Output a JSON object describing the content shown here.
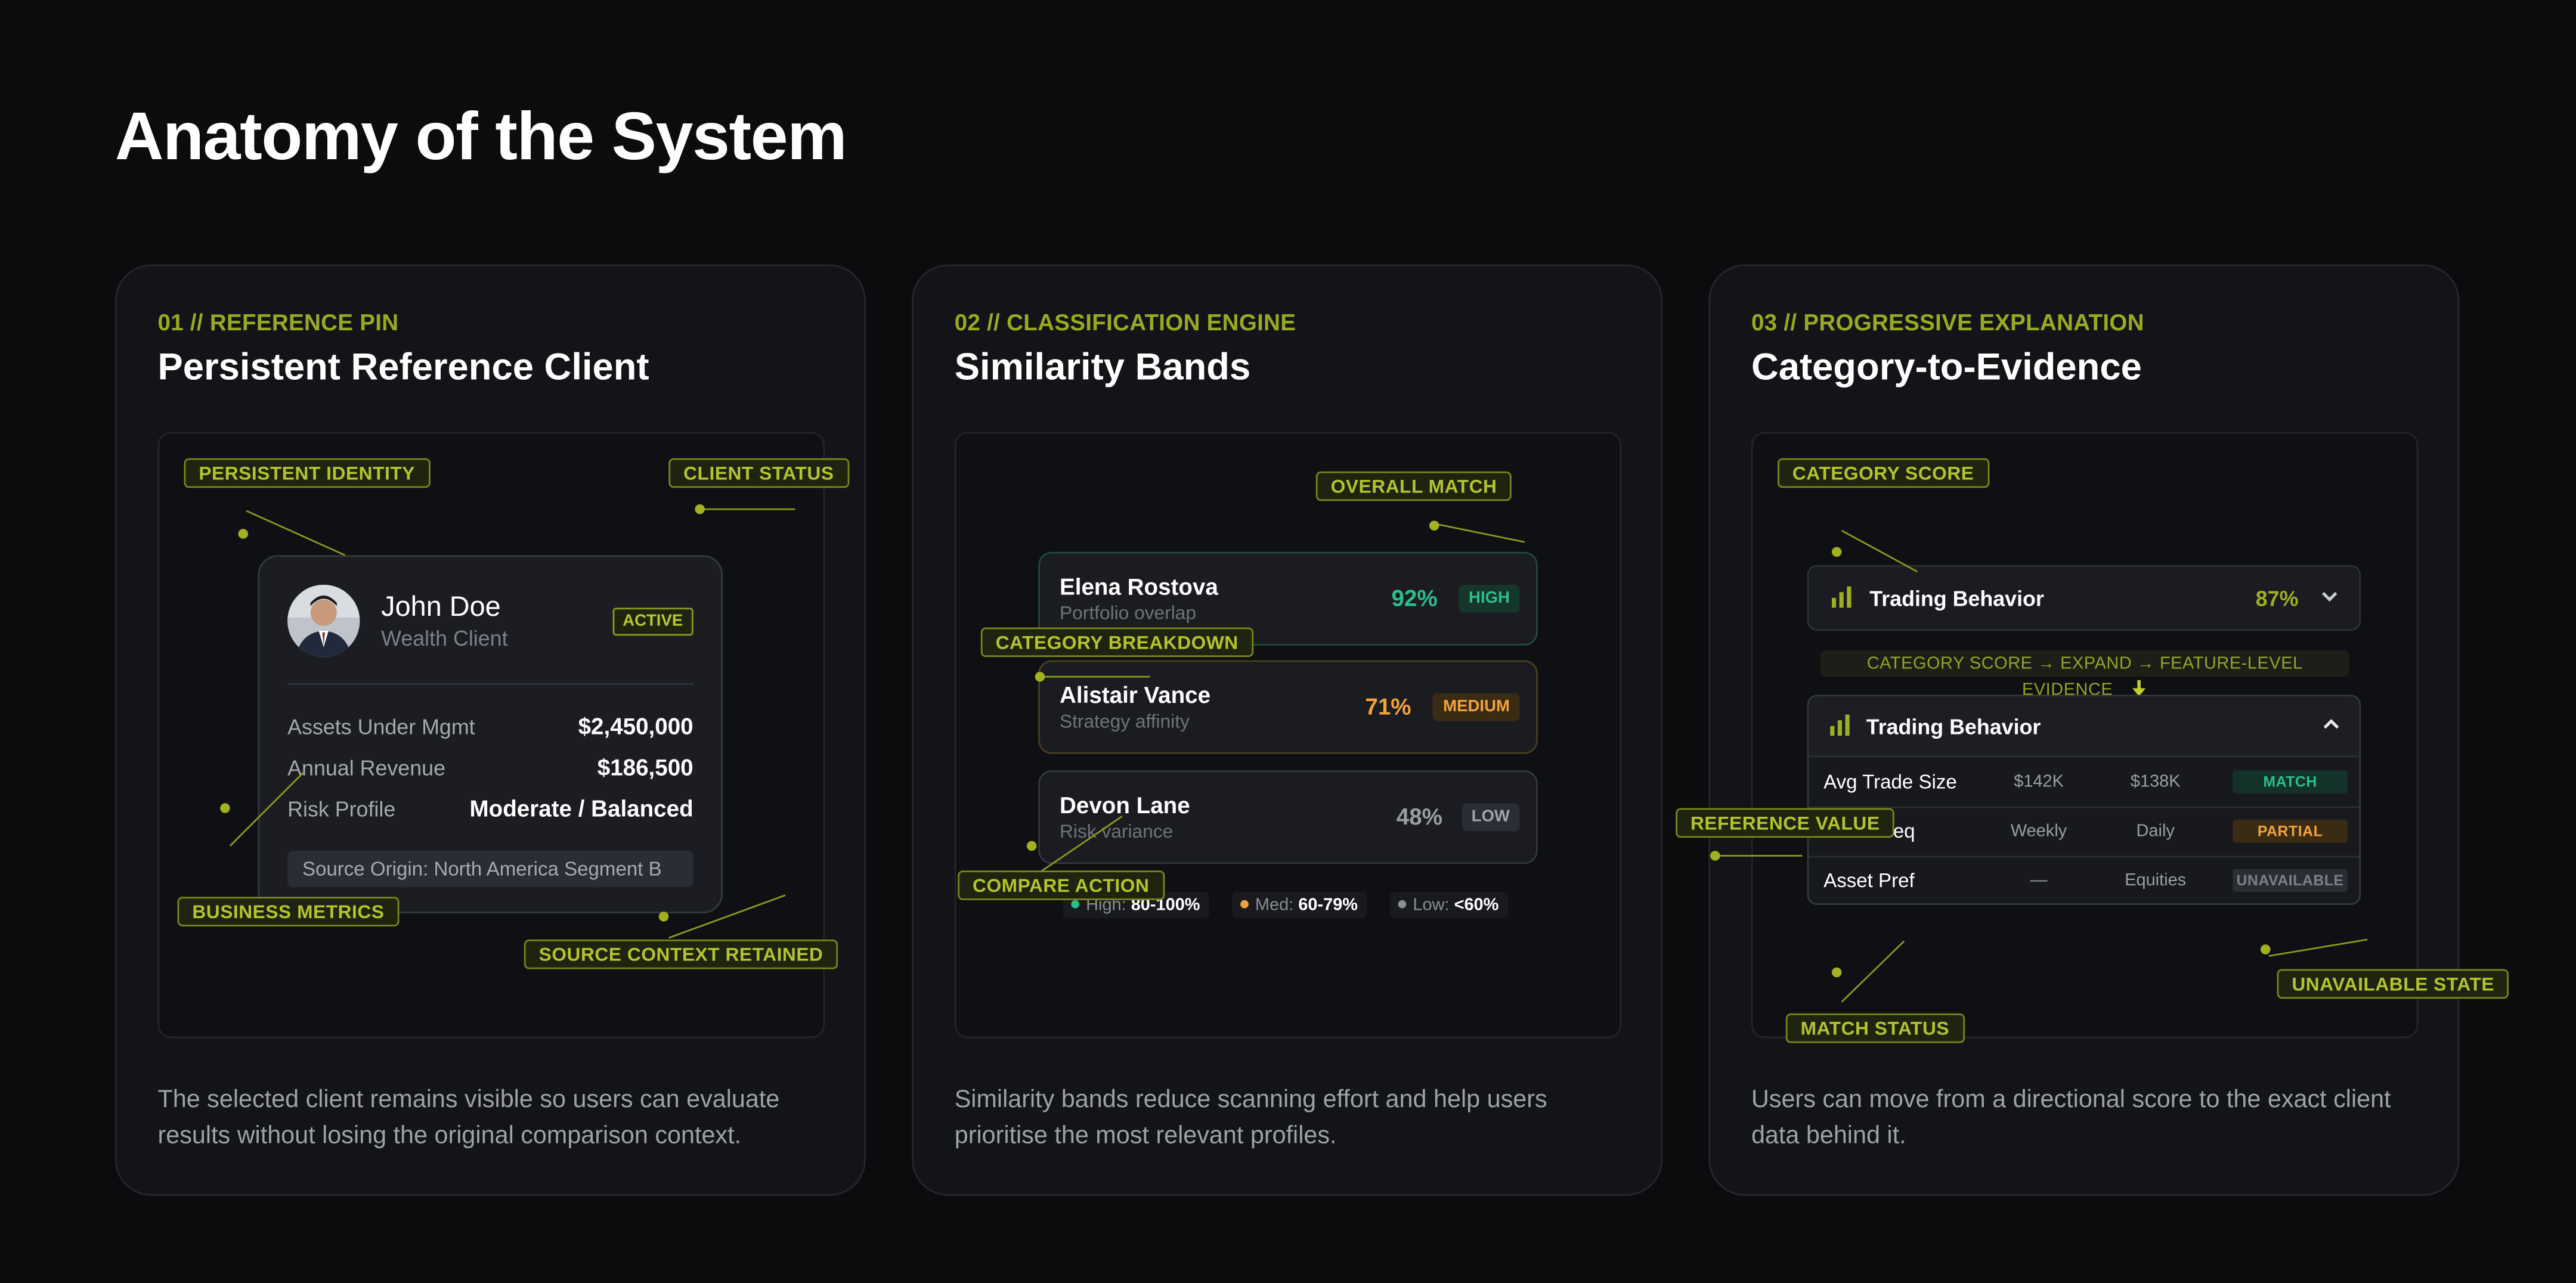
{
  "page": {
    "title": "Anatomy of the System"
  },
  "colors": {
    "accent": "#9aa922",
    "high": "#2bbf8a",
    "medium": "#f2a23a",
    "low": "#8a8d92",
    "background": "#0b0c0e",
    "panel": "#131417"
  },
  "panels": [
    {
      "eyebrow": "01 // REFERENCE PIN",
      "title": "Persistent Reference Client",
      "description": "The selected client remains visible so users can evaluate results without losing the original comparison context.",
      "annotations": {
        "identity": "PERSISTENT IDENTITY",
        "status": "CLIENT STATUS",
        "metrics": "BUSINESS METRICS",
        "source": "SOURCE CONTEXT RETAINED"
      },
      "client": {
        "name": "John Doe",
        "role": "Wealth Client",
        "status": "ACTIVE",
        "avatar_icon": "user-avatar-photo",
        "metrics": [
          {
            "label": "Assets Under Mgmt",
            "value": "$2,450,000"
          },
          {
            "label": "Annual Revenue",
            "value": "$186,500"
          },
          {
            "label": "Risk Profile",
            "value": "Moderate / Balanced"
          }
        ],
        "source": "Source Origin: North America Segment B"
      }
    },
    {
      "eyebrow": "02 // CLASSIFICATION ENGINE",
      "title": "Similarity Bands",
      "description": "Similarity bands reduce scanning effort and help users prioritise the most relevant profiles.",
      "annotations": {
        "overall": "OVERALL MATCH",
        "breakdown": "CATEGORY BREAKDOWN",
        "compare": "COMPARE ACTION"
      },
      "matches": [
        {
          "name": "Elena Rostova",
          "sub": "Portfolio overlap",
          "pct": "92%",
          "band": "HIGH"
        },
        {
          "name": "Alistair Vance",
          "sub": "Strategy affinity",
          "pct": "71%",
          "band": "MEDIUM"
        },
        {
          "name": "Devon Lane",
          "sub": "Risk variance",
          "pct": "48%",
          "band": "LOW"
        }
      ],
      "legend": [
        {
          "label": "High:",
          "range": "80-100%"
        },
        {
          "label": "Med:",
          "range": "60-79%"
        },
        {
          "label": "Low:",
          "range": "<60%"
        }
      ]
    },
    {
      "eyebrow": "03 // PROGRESSIVE EXPLANATION",
      "title": "Category-to-Evidence",
      "description": "Users can move from a directional score to the exact client data behind it.",
      "annotations": {
        "category": "CATEGORY SCORE",
        "reference": "REFERENCE VALUE",
        "match_status": "MATCH STATUS",
        "unavailable": "UNAVAILABLE STATE"
      },
      "category_row": {
        "name": "Trading Behavior",
        "score": "87%",
        "icon": "bar-chart-icon",
        "chevron": "chevron-down-icon"
      },
      "flow": "CATEGORY SCORE → EXPAND → FEATURE-LEVEL EVIDENCE",
      "flow_icon": "arrow-down-icon",
      "evidence": {
        "title": "Trading Behavior",
        "chevron": "chevron-up-icon",
        "rows": [
          {
            "feature": "Avg Trade Size",
            "reference": "$142K",
            "candidate": "$138K",
            "status": "MATCH"
          },
          {
            "feature": "Freq",
            "reference": "Weekly",
            "candidate": "Daily",
            "status": "PARTIAL"
          },
          {
            "feature": "Asset Pref",
            "reference": "—",
            "candidate": "Equities",
            "status": "UNAVAILABLE"
          }
        ]
      }
    }
  ]
}
